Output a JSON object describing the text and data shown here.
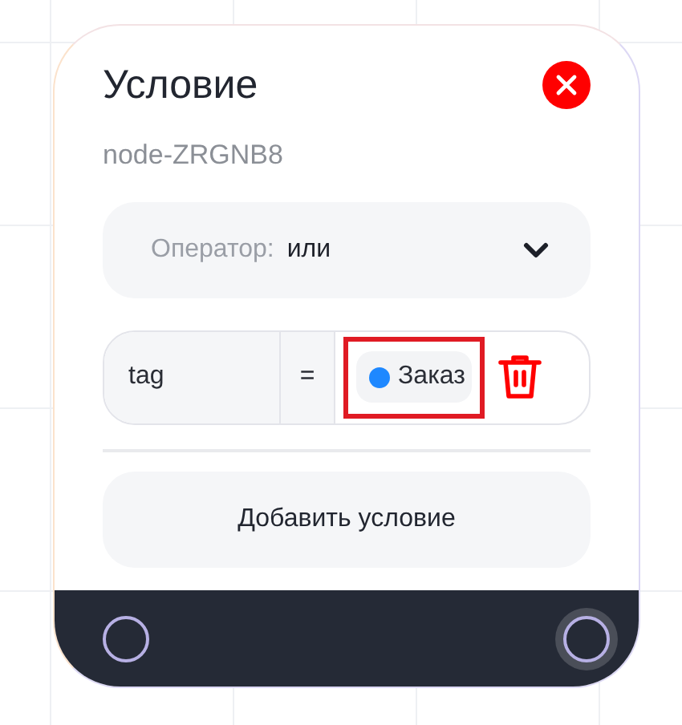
{
  "node": {
    "title": "Условие",
    "id": "node-ZRGNB8",
    "operator": {
      "label": "Оператор:",
      "value": "или"
    },
    "conditions": [
      {
        "field": "tag",
        "op": "=",
        "value": "Заказ",
        "color": "#1e88ff",
        "highlighted": true
      }
    ],
    "add_button": "Добавить условие",
    "handles": [
      {
        "selected": false
      },
      {
        "selected": true
      }
    ]
  }
}
